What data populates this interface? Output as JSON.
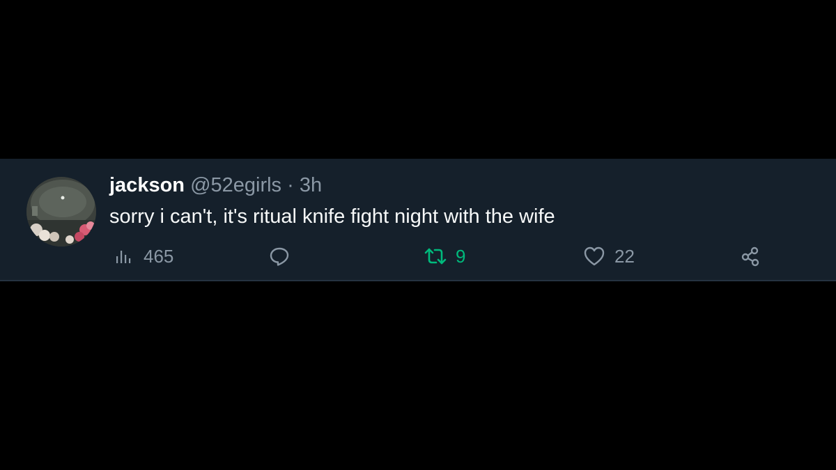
{
  "tweet": {
    "author_name": "jackson",
    "handle": "@52egirls",
    "separator": "·",
    "time": "3h",
    "text": "sorry i can't, it's ritual knife fight night with the wife",
    "avatar_icon": "profile-photo",
    "actions": {
      "views": {
        "icon": "analytics-icon",
        "count": "465"
      },
      "reply": {
        "icon": "reply-icon",
        "count": ""
      },
      "retweet": {
        "icon": "retweet-icon",
        "count": "9",
        "active": true
      },
      "like": {
        "icon": "heart-icon",
        "count": "22"
      },
      "share": {
        "icon": "share-icon"
      }
    }
  },
  "colors": {
    "background": "#000000",
    "tweet_background": "#15202b",
    "primary_text": "#f7f9f9",
    "secondary_text": "#8b98a5",
    "retweet_active": "#00ba7c"
  }
}
